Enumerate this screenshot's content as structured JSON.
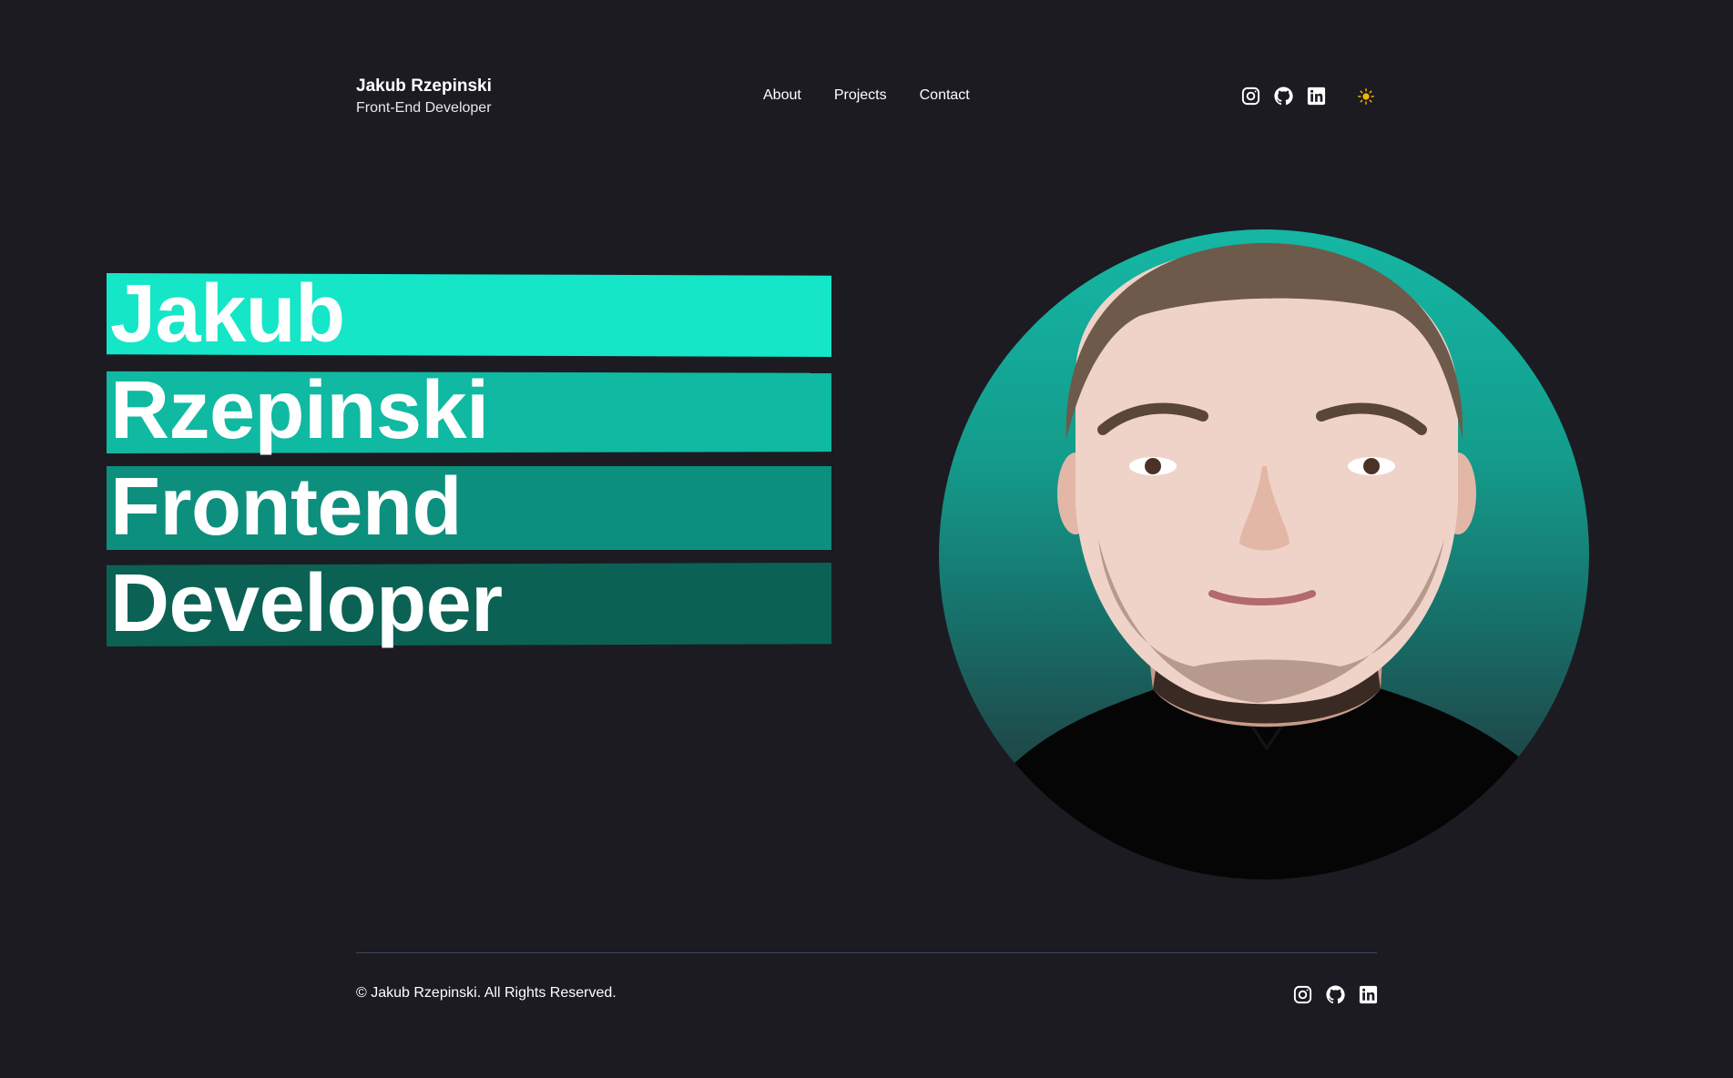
{
  "header": {
    "brand_name": "Jakub Rzepinski",
    "brand_role": "Front-End Developer",
    "nav": [
      {
        "label": "About"
      },
      {
        "label": "Projects"
      },
      {
        "label": "Contact"
      }
    ],
    "social": [
      {
        "icon": "instagram-icon"
      },
      {
        "icon": "github-icon"
      },
      {
        "icon": "linkedin-icon"
      }
    ],
    "theme_toggle_icon": "sun-icon"
  },
  "hero": {
    "lines": [
      "Jakub",
      "Rzepinski",
      "Frontend",
      "Developer"
    ],
    "band_colors": [
      "#15e6c8",
      "#10b9a1",
      "#0d8f7d",
      "#0b6254"
    ],
    "portrait": "portrait-photo"
  },
  "footer": {
    "copyright": "© Jakub Rzepinski. All Rights Reserved.",
    "social": [
      {
        "icon": "instagram-icon"
      },
      {
        "icon": "github-icon"
      },
      {
        "icon": "linkedin-icon"
      }
    ]
  },
  "colors": {
    "background": "#1c1b21",
    "accent": "#15e6c8",
    "sun": "#f5b800",
    "rule": "#3b4a5e"
  }
}
